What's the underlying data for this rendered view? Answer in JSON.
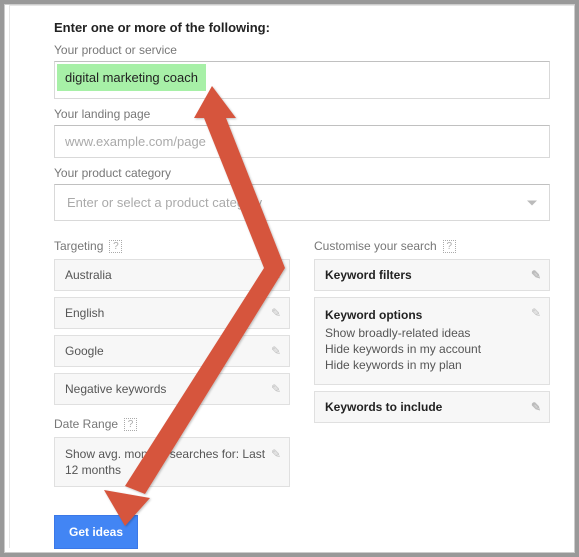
{
  "heading": "Enter one or more of the following:",
  "product_label": "Your product or service",
  "product_value": "digital marketing coach",
  "landing_label": "Your landing page",
  "landing_placeholder": "www.example.com/page",
  "category_label": "Your product category",
  "category_placeholder": "Enter or select a product category",
  "targeting": {
    "title": "Targeting",
    "items": [
      "Australia",
      "English",
      "Google",
      "Negative keywords"
    ]
  },
  "date_range": {
    "title": "Date Range",
    "text": "Show avg. monthly searches for: Last 12 months"
  },
  "customise": {
    "title": "Customise your search",
    "filters": "Keyword filters",
    "options_title": "Keyword options",
    "options": [
      "Show broadly-related ideas",
      "Hide keywords in my account",
      "Hide keywords in my plan"
    ],
    "include": "Keywords to include"
  },
  "button": "Get ideas"
}
